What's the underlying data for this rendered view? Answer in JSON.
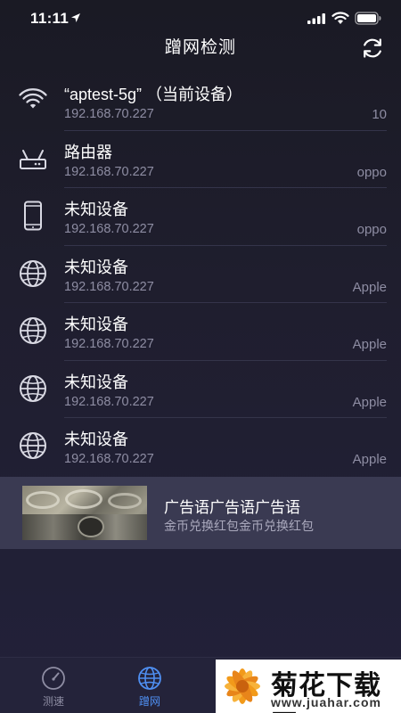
{
  "status_bar": {
    "time": "11:11"
  },
  "header": {
    "title": "蹭网检测"
  },
  "devices": [
    {
      "icon": "wifi-icon",
      "name": "“aptest-5g” （当前设备）",
      "ip": "192.168.70.227",
      "vendor": "10"
    },
    {
      "icon": "router-icon",
      "name": "路由器",
      "ip": "192.168.70.227",
      "vendor": "oppo"
    },
    {
      "icon": "phone-icon",
      "name": "未知设备",
      "ip": "192.168.70.227",
      "vendor": "oppo"
    },
    {
      "icon": "globe-icon",
      "name": "未知设备",
      "ip": "192.168.70.227",
      "vendor": "Apple"
    },
    {
      "icon": "globe-icon",
      "name": "未知设备",
      "ip": "192.168.70.227",
      "vendor": "Apple"
    },
    {
      "icon": "globe-icon",
      "name": "未知设备",
      "ip": "192.168.70.227",
      "vendor": "Apple"
    },
    {
      "icon": "globe-icon",
      "name": "未知设备",
      "ip": "192.168.70.227",
      "vendor": "Apple"
    }
  ],
  "ad": {
    "title": "广告语广告语广告语",
    "subtitle": "金币兑换红包金币兑换红包"
  },
  "tabs": [
    {
      "label": "测速",
      "icon": "speedometer-icon",
      "active": false
    },
    {
      "label": "蹭网",
      "icon": "globe-icon",
      "active": true
    }
  ],
  "watermark": {
    "text": "菊花下载网",
    "url": "www.juahar.com"
  },
  "colors": {
    "accent": "#4f8ff2",
    "background": "#1d1c2c",
    "secondary_text": "#8e8da3"
  }
}
